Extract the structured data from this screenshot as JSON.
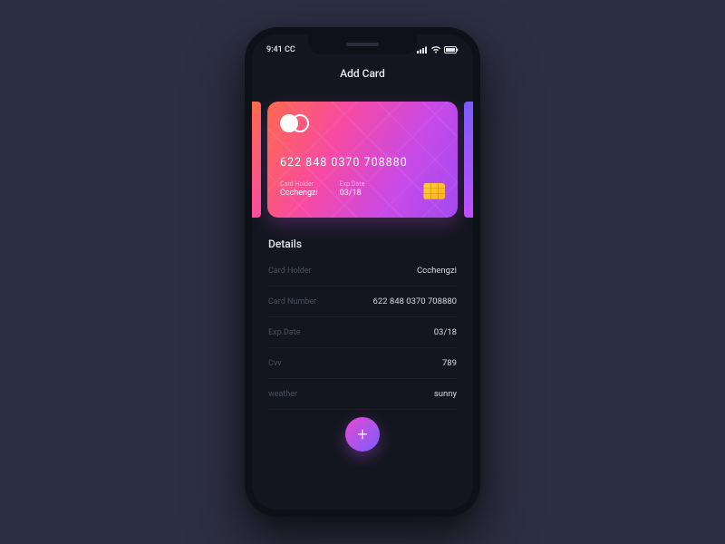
{
  "status": {
    "time": "9:41 CC"
  },
  "header": {
    "title": "Add Card"
  },
  "card": {
    "number": "622 848 0370 708880",
    "holder_label": "Card Holder",
    "holder_value": "Ccchengzi",
    "exp_label": "Exp.Date",
    "exp_value": "03/18"
  },
  "details": {
    "title": "Details",
    "rows": [
      {
        "label": "Card Holder",
        "value": "Ccchengzi"
      },
      {
        "label": "Card Number",
        "value": "622 848 0370 708880"
      },
      {
        "label": "Exp.Date",
        "value": "03/18"
      },
      {
        "label": "Cvv",
        "value": "789"
      },
      {
        "label": "weather",
        "value": "sunny"
      }
    ]
  },
  "fab": {
    "glyph": "+"
  }
}
